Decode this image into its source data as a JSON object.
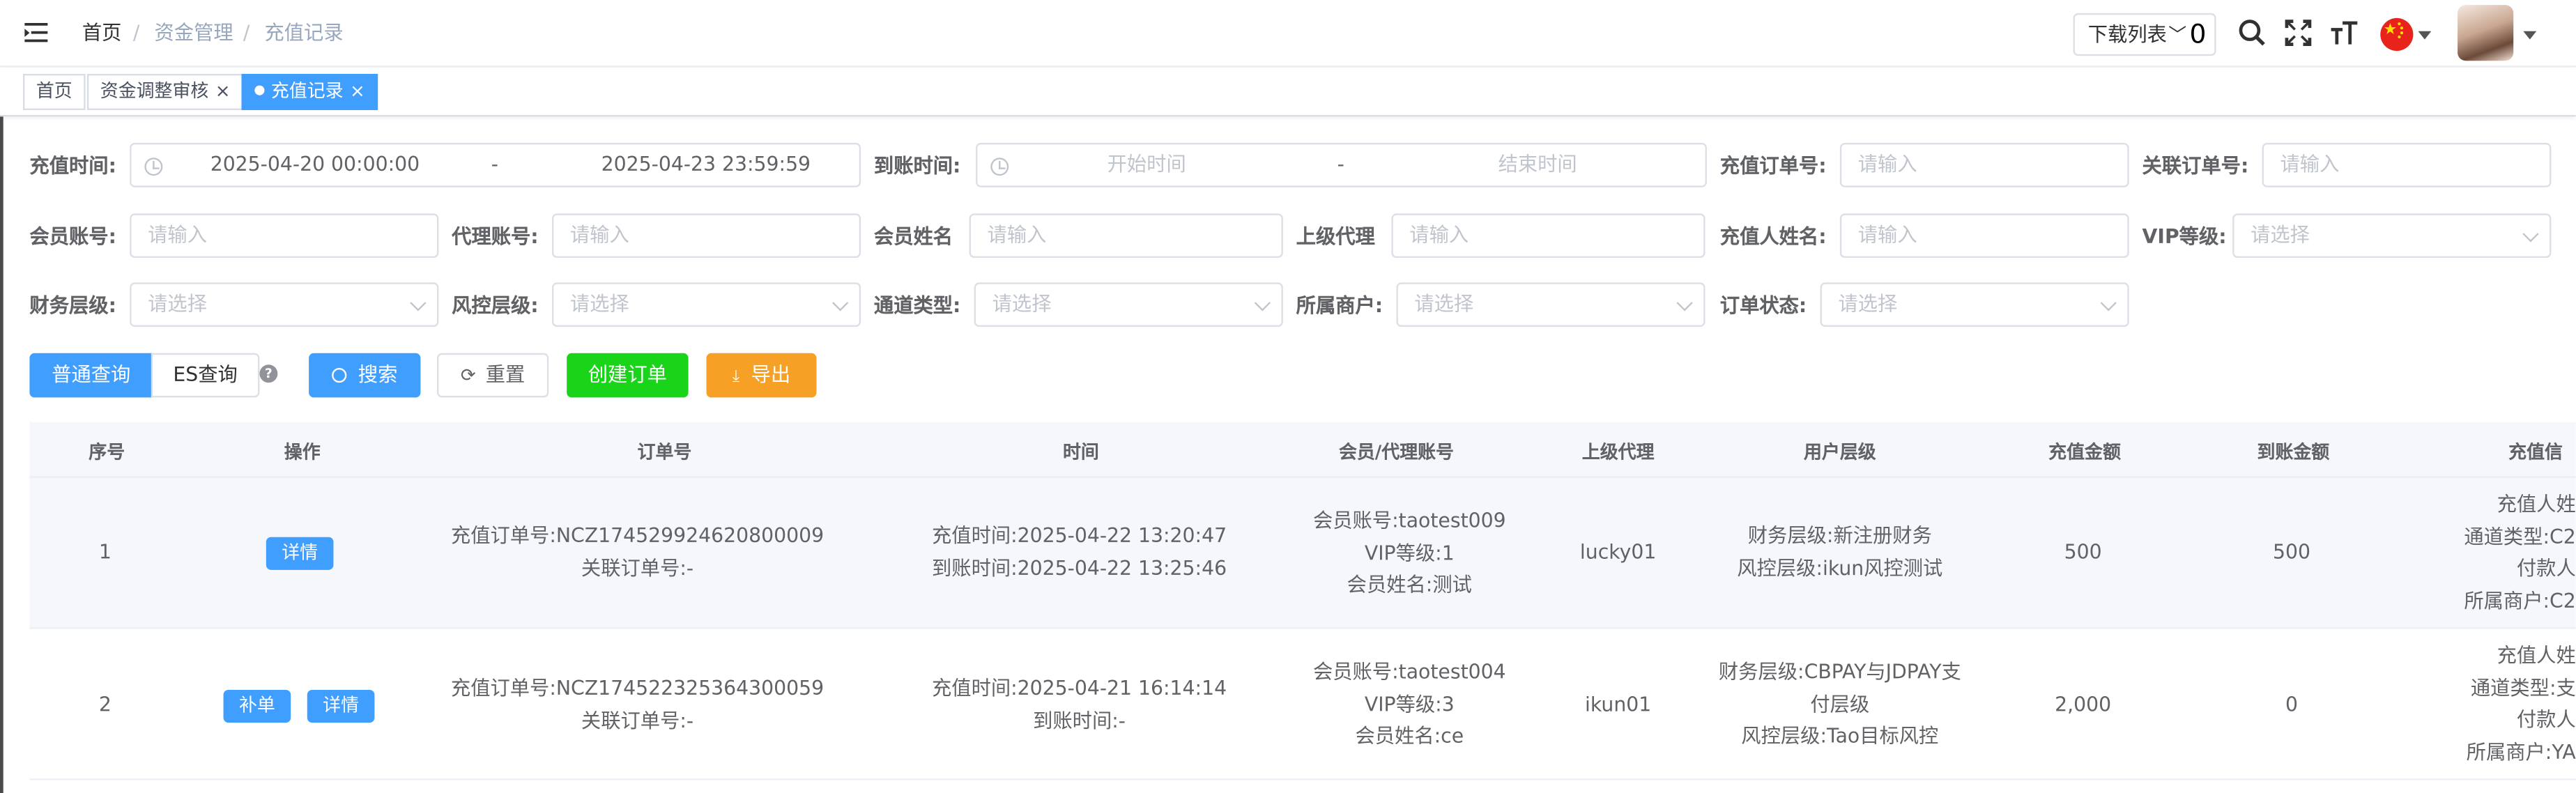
{
  "header": {
    "breadcrumb": [
      "首页",
      "资金管理",
      "充值记录"
    ],
    "separator": "/",
    "download_list_label": "下载列表",
    "download_count": "0",
    "language_flag": "CN"
  },
  "tags": [
    {
      "label": "首页",
      "closable": false,
      "active": false
    },
    {
      "label": "资金调整审核",
      "closable": true,
      "active": false
    },
    {
      "label": "充值记录",
      "closable": true,
      "active": true
    }
  ],
  "tag_close_glyph": "×",
  "filters": {
    "recharge_time": {
      "label": "充值时间:",
      "start": "2025-04-20 00:00:00",
      "end": "2025-04-23 23:59:59",
      "sep": "-"
    },
    "arrival_time": {
      "label": "到账时间:",
      "start_placeholder": "开始时间",
      "end_placeholder": "结束时间",
      "sep": "-"
    },
    "recharge_order_no": {
      "label": "充值订单号:",
      "placeholder": "请输入"
    },
    "related_order_no": {
      "label": "关联订单号:",
      "placeholder": "请输入"
    },
    "member_account": {
      "label": "会员账号:",
      "placeholder": "请输入"
    },
    "agent_account": {
      "label": "代理账号:",
      "placeholder": "请输入"
    },
    "member_name": {
      "label": "会员姓名",
      "placeholder": "请输入"
    },
    "superior_agent": {
      "label": "上级代理",
      "placeholder": "请输入"
    },
    "payer_name": {
      "label": "充值人姓名:",
      "placeholder": "请输入"
    },
    "vip_level": {
      "label": "VIP等级:",
      "placeholder": "请选择"
    },
    "finance_level": {
      "label": "财务层级:",
      "placeholder": "请选择"
    },
    "risk_level": {
      "label": "风控层级:",
      "placeholder": "请选择"
    },
    "channel_type": {
      "label": "通道类型:",
      "placeholder": "请选择"
    },
    "merchant": {
      "label": "所属商户:",
      "placeholder": "请选择"
    },
    "order_status": {
      "label": "订单状态:",
      "placeholder": "请选择"
    }
  },
  "actions": {
    "normal_query": "普通查询",
    "es_query": "ES查询",
    "help": "?",
    "search": "搜索",
    "reset": "重置",
    "create_order": "创建订单",
    "export": "导出"
  },
  "table": {
    "columns": [
      "序号",
      "操作",
      "订单号",
      "时间",
      "会员/代理账号",
      "上级代理",
      "用户层级",
      "充值金额",
      "到账金额",
      "充值信"
    ],
    "rows": [
      {
        "index": "1",
        "buttons": [
          "详情"
        ],
        "order": [
          "充值订单号:NCZ174529924620800009",
          "关联订单号:-"
        ],
        "time": [
          "充值时间:2025-04-22 13:20:47",
          "到账时间:2025-04-22 13:25:46"
        ],
        "member": [
          "会员账号:taotest009",
          "VIP等级:1",
          "会员姓名:测试"
        ],
        "superior": "lucky01",
        "level": [
          "财务层级:新注册财务",
          "风控层级:ikun风控测试"
        ],
        "amount": "500",
        "arrived": "500",
        "recharge_info": [
          "充值人姓",
          "通道类型:C2",
          "付款人",
          "所属商户:C2"
        ]
      },
      {
        "index": "2",
        "buttons": [
          "补单",
          "详情"
        ],
        "order": [
          "充值订单号:NCZ174522325364300059",
          "关联订单号:-"
        ],
        "time": [
          "充值时间:2025-04-21 16:14:14",
          "到账时间:-"
        ],
        "member": [
          "会员账号:taotest004",
          "VIP等级:3",
          "会员姓名:ce"
        ],
        "superior": "ikun01",
        "level": [
          "财务层级:CBPAY与JDPAY支",
          "付层级",
          "风控层级:Tao目标风控"
        ],
        "amount": "2,000",
        "arrived": "0",
        "recharge_info": [
          "充值人姓",
          "通道类型:支",
          "付款人",
          "所属商户:YA"
        ]
      }
    ]
  },
  "colors": {
    "primary": "#409eff",
    "success": "#1ad41a",
    "warning": "#f7a026",
    "text": "#606266"
  }
}
